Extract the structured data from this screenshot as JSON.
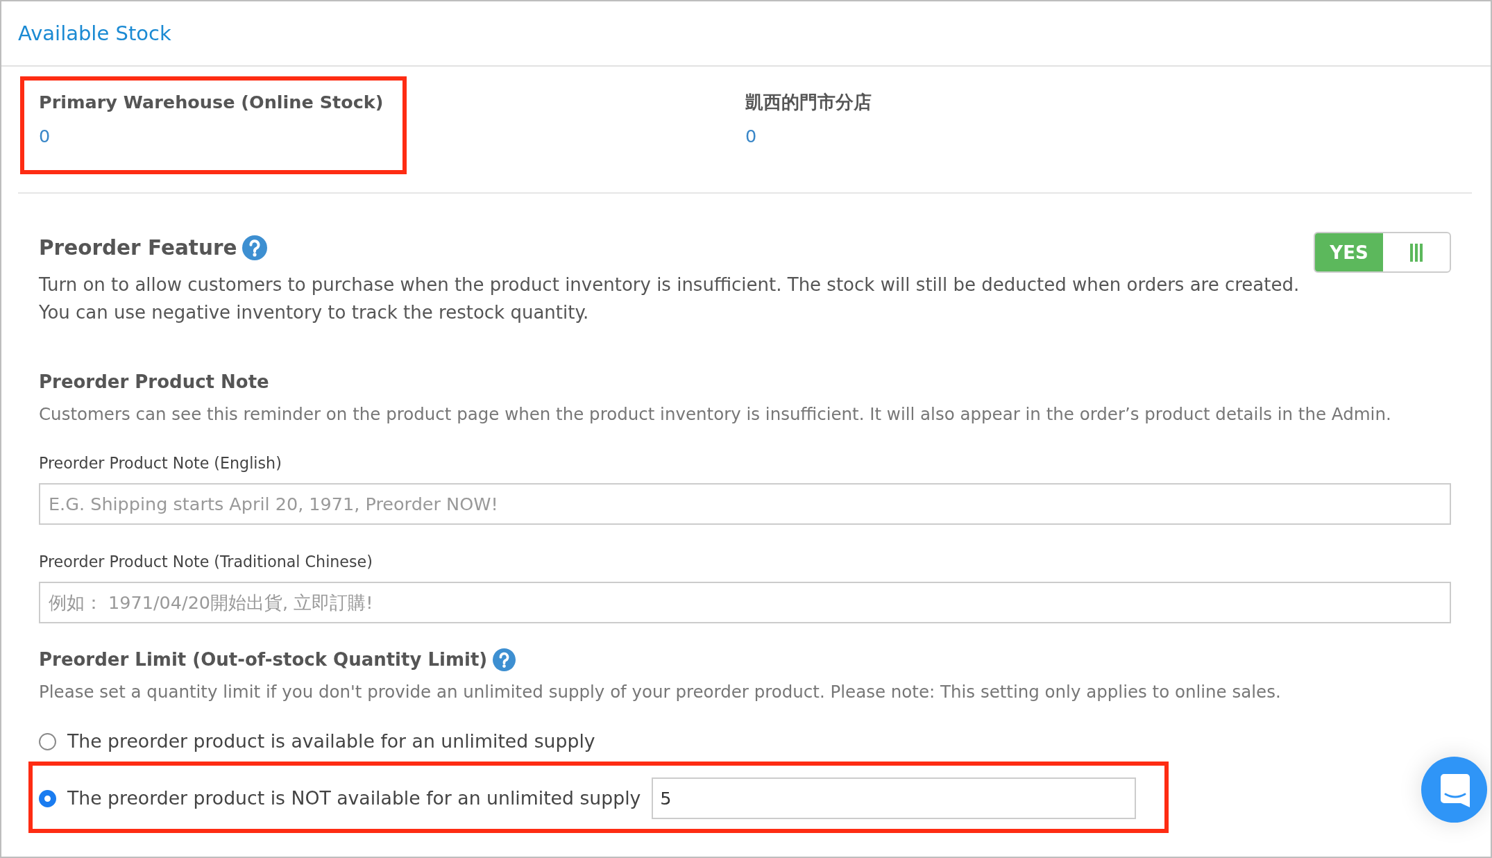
{
  "header": {
    "title": "Available Stock"
  },
  "warehouses": [
    {
      "name": "Primary Warehouse (Online Stock)",
      "quantity": "0",
      "highlighted": true
    },
    {
      "name": "凱西的門市分店",
      "quantity": "0",
      "highlighted": false
    }
  ],
  "preorder_feature": {
    "title": "Preorder Feature",
    "on": true,
    "on_label": "YES",
    "description": "Turn on to allow customers to purchase when the product inventory is insufficient. The stock will still be deducted when orders are created.\nYou can use negative inventory to track the restock quantity."
  },
  "product_note": {
    "title": "Preorder Product Note",
    "description": "Customers can see this reminder on the product page when the product inventory is insufficient. It will also appear in the order’s product details in the Admin.",
    "fields": [
      {
        "label": "Preorder Product Note (English)",
        "placeholder": "E.G. Shipping starts April 20, 1971, Preorder NOW!"
      },
      {
        "label": "Preorder Product Note (Traditional Chinese)",
        "placeholder": "例如： 1971/04/20開始出貨, 立即訂購!"
      }
    ]
  },
  "preorder_limit": {
    "title": "Preorder Limit (Out-of-stock Quantity Limit)",
    "description": "Please set a quantity limit if you don't provide an unlimited supply of your preorder product. Please note: This setting only applies to online sales.",
    "options": [
      {
        "kind": "plain",
        "label": "The preorder product is available for an unlimited supply",
        "selected": false,
        "highlighted": false
      },
      {
        "kind": "quantity",
        "label": "The preorder product is NOT available for an unlimited supply",
        "selected": true,
        "highlighted": true,
        "value": "5"
      }
    ]
  }
}
